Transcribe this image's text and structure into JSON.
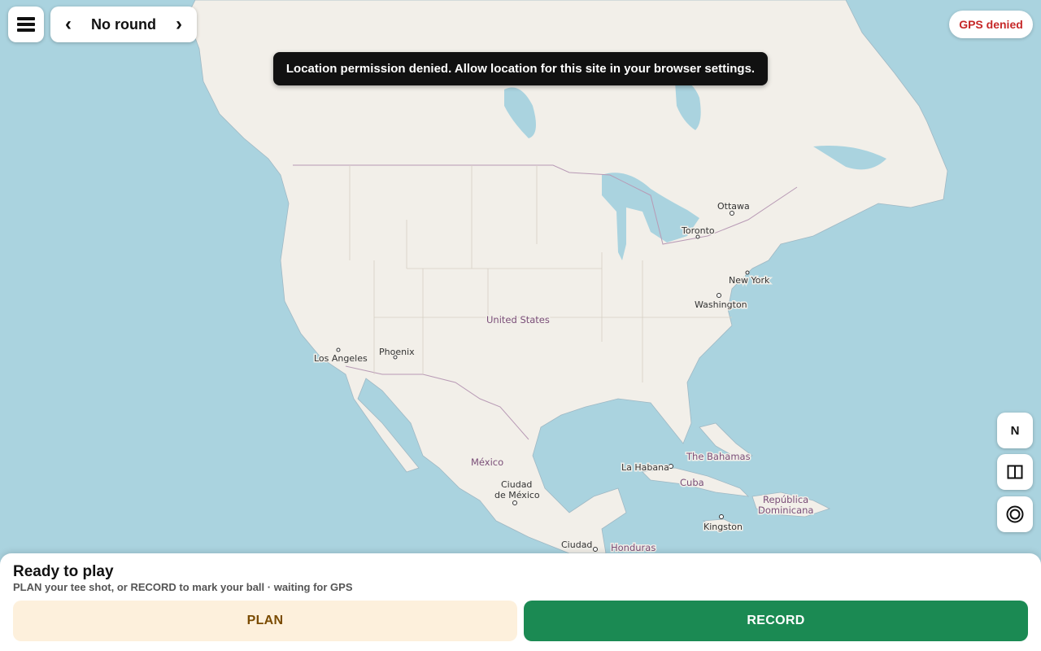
{
  "header": {
    "menu_icon": "hamburger-icon",
    "round": {
      "prev_icon": "chevron-left-icon",
      "label": "No round",
      "next_icon": "chevron-right-icon",
      "prev_glyph": "‹",
      "next_glyph": "›"
    },
    "gps_status": "GPS denied",
    "gps_status_color": "#c62828"
  },
  "toast": {
    "message": "Location permission denied. Allow location for this site in your browser settings."
  },
  "map": {
    "labels": {
      "ottawa": "Ottawa",
      "toronto": "Toronto",
      "new_york": "New York",
      "washington": "Washington",
      "united_states": "United States",
      "phoenix": "Phoenix",
      "los_angeles": "Los Angeles",
      "mexico": "México",
      "ciudad_de_mexico_1": "Ciudad",
      "ciudad_de_mexico_2": "de México",
      "la_habana": "La Habana",
      "the_bahamas": "The Bahamas",
      "cuba": "Cuba",
      "republica_1": "República",
      "republica_2": "Dominicana",
      "kingston": "Kingston",
      "honduras": "Honduras",
      "ciudad_guatemala": "Ciudad"
    },
    "controls": {
      "north_label": "N",
      "layers_icon": "split-view-icon",
      "locate_icon": "target-icon"
    },
    "colors": {
      "water": "#aad3df",
      "land": "#f2efe9"
    }
  },
  "panel": {
    "title": "Ready to play",
    "subtitle": "PLAN your tee shot, or RECORD to mark your ball · waiting for GPS",
    "plan_label": "PLAN",
    "record_label": "RECORD",
    "record_color": "#1b8a53",
    "plan_color": "#fdf0dc"
  }
}
